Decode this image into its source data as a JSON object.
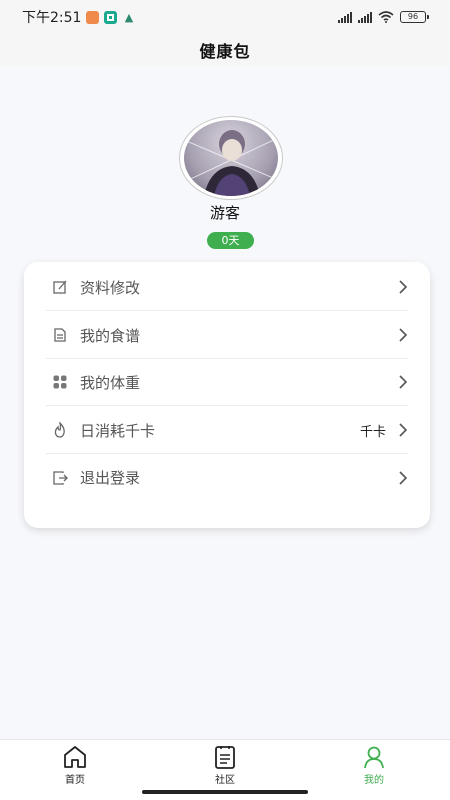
{
  "status_bar": {
    "time": "下午2:51",
    "battery": "96"
  },
  "header": {
    "title": "健康包"
  },
  "profile": {
    "username": "游客",
    "days_badge": "0天"
  },
  "menu": [
    {
      "label": "资料修改",
      "icon": "edit-icon",
      "value": ""
    },
    {
      "label": "我的食谱",
      "icon": "recipe-icon",
      "value": ""
    },
    {
      "label": "我的体重",
      "icon": "grid-icon",
      "value": ""
    },
    {
      "label": "日消耗千卡",
      "icon": "flame-icon",
      "value": "千卡"
    },
    {
      "label": "退出登录",
      "icon": "logout-icon",
      "value": ""
    }
  ],
  "tabs": [
    {
      "label": "首页",
      "icon": "home-icon",
      "active": false
    },
    {
      "label": "社区",
      "icon": "community-icon",
      "active": false
    },
    {
      "label": "我的",
      "icon": "person-icon",
      "active": true
    }
  ],
  "colors": {
    "accent": "#3fae4f",
    "background": "#f7f8fb"
  }
}
